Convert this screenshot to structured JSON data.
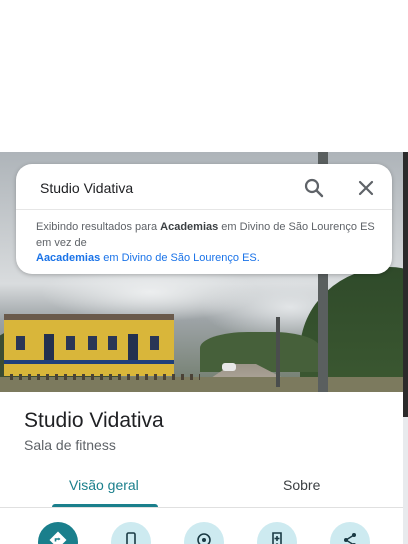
{
  "search": {
    "query": "Studio Vidativa",
    "suggestion": {
      "prefix": "Exibindo resultados para ",
      "corrected_term": "Academias",
      "middle": " em Divino de São Lourenço ES em vez de",
      "original_term": "Aacademias",
      "suffix": " em Divino de São Lourenço ES."
    }
  },
  "place": {
    "name": "Studio Vidativa",
    "category": "Sala de fitness"
  },
  "tabs": [
    {
      "label": "Visão geral",
      "active": true
    },
    {
      "label": "Sobre",
      "active": false
    }
  ],
  "actions": [
    {
      "icon": "directions-icon"
    },
    {
      "icon": "phone-icon"
    },
    {
      "icon": "nearby-icon"
    },
    {
      "icon": "save-icon"
    },
    {
      "icon": "share-icon"
    }
  ],
  "colors": {
    "accent": "#1a7f8c",
    "action_bg": "#cdeaf0",
    "link": "#1a73e8"
  }
}
